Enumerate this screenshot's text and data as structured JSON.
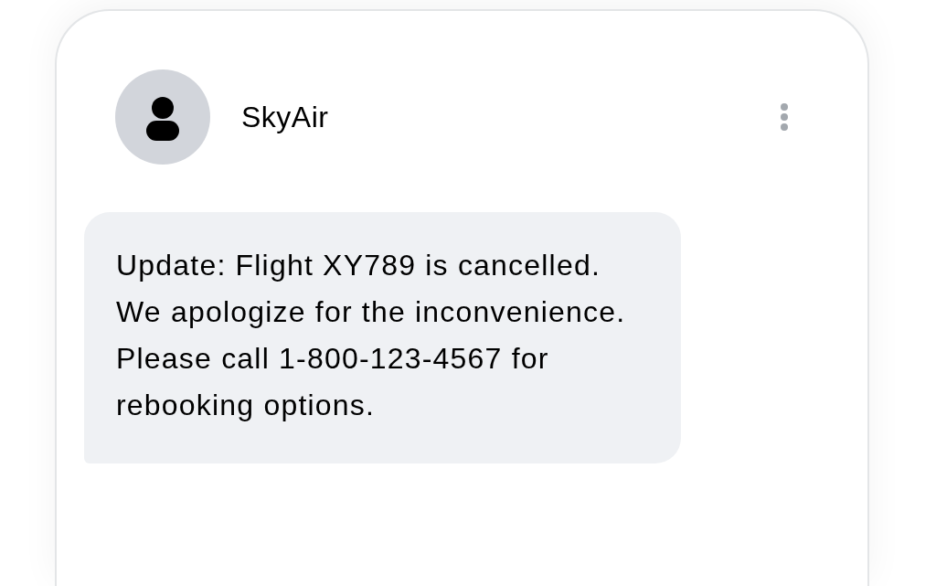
{
  "contact": {
    "name": "SkyAir"
  },
  "messages": [
    {
      "text": "Update: Flight XY789 is cancelled. We apologize for the inconvenience. Please call 1-800-123-4567 for rebooking options."
    }
  ]
}
